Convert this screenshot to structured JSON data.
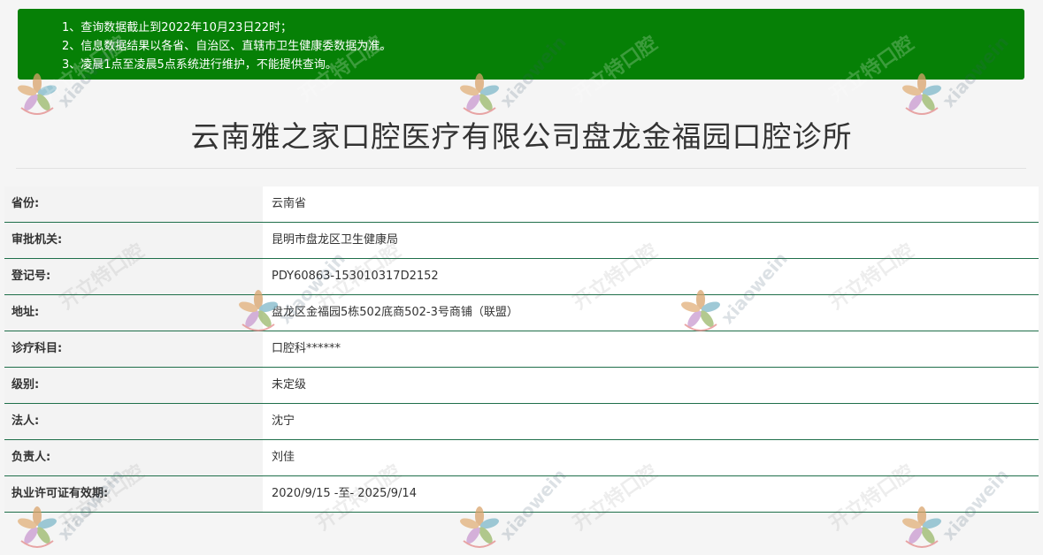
{
  "notice": {
    "lines": [
      "1、查询数据截止到2022年10月23日22时；",
      "2、信息数据结果以各省、自治区、直辖市卫生健康委数据为准。",
      "3、凌晨1点至凌晨5点系统进行维护，不能提供查询。"
    ],
    "background": "#068006"
  },
  "page_title": "云南雅之家口腔医疗有限公司盘龙金福园口腔诊所",
  "rows": [
    {
      "label": "省份:",
      "value": "云南省"
    },
    {
      "label": "审批机关:",
      "value": "昆明市盘龙区卫生健康局"
    },
    {
      "label": "登记号:",
      "value": "PDY60863-153010317D2152"
    },
    {
      "label": "地址:",
      "value": "盘龙区金福园5栋502底商502-3号商铺（联盟）"
    },
    {
      "label": "诊疗科目:",
      "value": "口腔科******"
    },
    {
      "label": "级别:",
      "value": "未定级"
    },
    {
      "label": "法人:",
      "value": "沈宁"
    },
    {
      "label": "负责人:",
      "value": "刘佳"
    },
    {
      "label": "执业许可证有效期:",
      "value": "2020/9/15 -至- 2025/9/14"
    }
  ],
  "watermark": {
    "brand": "xiaowein",
    "cn": "开立特口腔"
  }
}
